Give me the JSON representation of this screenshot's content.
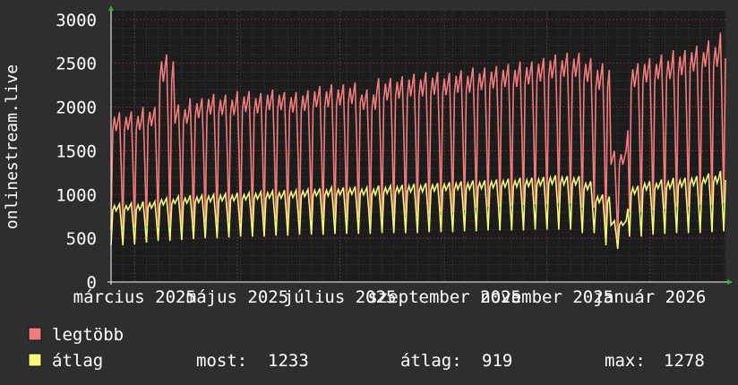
{
  "colors": {
    "background": "#2e2e2e",
    "plot_background": "#1c1c1c",
    "grid_major": "#6a2e2e",
    "grid_minor": "#3a3a3a",
    "series_max": "#f07c7c",
    "series_avg": "#f7f77a",
    "axis_arrow": "#2db82d"
  },
  "chart_data": {
    "type": "line",
    "title": "",
    "ylabel": "onlinestream.live",
    "ylim": [
      0,
      3100
    ],
    "y_ticks": [
      0,
      500,
      1000,
      1500,
      2000,
      2500,
      3000
    ],
    "x_tick_labels": [
      "március 2025",
      "május 2025",
      "július 2025",
      "szeptember 2025",
      "november 2025",
      "január 2026"
    ],
    "x_range_days": 365,
    "x_tick_days": [
      14,
      75,
      136,
      198,
      259,
      320
    ],
    "grid": true,
    "legend_position": "bottom-left",
    "series": [
      {
        "name": "legtöbb",
        "key": "max",
        "weekly_peak": [
          1940,
          1950,
          2000,
          2600,
          2030,
          2100,
          2150,
          2140,
          2180,
          2160,
          2200,
          2170,
          2190,
          2240,
          2260,
          2280,
          2200,
          2330,
          2350,
          2380,
          2400,
          2390,
          2420,
          2450,
          2470,
          2490,
          2520,
          2560,
          2600,
          2620,
          2560,
          2500,
          1500,
          2500,
          2560,
          2600,
          2650,
          2700,
          2760,
          2850
        ],
        "weekly_trough": [
          600,
          620,
          640,
          650,
          660,
          680,
          680,
          700,
          700,
          700,
          720,
          720,
          730,
          730,
          740,
          740,
          750,
          750,
          760,
          760,
          780,
          800,
          820,
          850,
          860,
          870,
          880,
          890,
          900,
          900,
          850,
          600,
          500,
          800,
          820,
          840,
          860,
          880,
          880,
          900
        ]
      },
      {
        "name": "átlag",
        "key": "avg",
        "weekly_peak": [
          890,
          900,
          920,
          960,
          980,
          990,
          1000,
          1010,
          1020,
          1030,
          1040,
          1050,
          1060,
          1070,
          1080,
          1090,
          1080,
          1100,
          1110,
          1120,
          1130,
          1140,
          1150,
          1160,
          1170,
          1180,
          1190,
          1200,
          1220,
          1210,
          1150,
          1000,
          700,
          1100,
          1150,
          1170,
          1190,
          1210,
          1240,
          1270
        ],
        "weekly_trough": [
          420,
          430,
          450,
          470,
          480,
          490,
          500,
          510,
          520,
          520,
          530,
          530,
          540,
          540,
          550,
          550,
          550,
          560,
          560,
          560,
          570,
          570,
          580,
          580,
          590,
          590,
          590,
          600,
          600,
          600,
          560,
          420,
          380,
          520,
          540,
          550,
          560,
          560,
          570,
          580
        ]
      }
    ]
  },
  "legend": {
    "max_label": "legtöbb",
    "avg_label": "átlag",
    "stats": {
      "most_label": "most:",
      "most_value": "1233",
      "atlag_label": "átlag:",
      "atlag_value": "919",
      "max_label": "max:",
      "max_value": "1278"
    }
  }
}
